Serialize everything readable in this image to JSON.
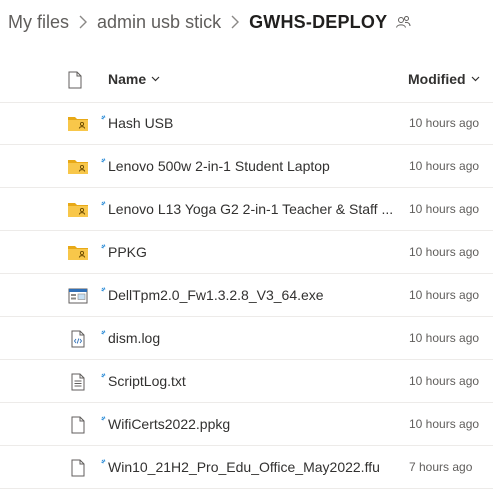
{
  "breadcrumb": {
    "items": [
      "My files",
      "admin usb stick"
    ],
    "current": "GWHS-DEPLOY"
  },
  "header": {
    "name_label": "Name",
    "modified_label": "Modified"
  },
  "files": [
    {
      "name": "Hash USB",
      "modified": "10 hours ago",
      "icon": "shared-folder-icon"
    },
    {
      "name": "Lenovo 500w 2-in-1 Student Laptop",
      "modified": "10 hours ago",
      "icon": "shared-folder-icon"
    },
    {
      "name": "Lenovo L13 Yoga G2 2-in-1 Teacher & Staff ...",
      "modified": "10 hours ago",
      "icon": "shared-folder-icon"
    },
    {
      "name": "PPKG",
      "modified": "10 hours ago",
      "icon": "shared-folder-icon"
    },
    {
      "name": "DellTpm2.0_Fw1.3.2.8_V3_64.exe",
      "modified": "10 hours ago",
      "icon": "exe-file-icon"
    },
    {
      "name": "dism.log",
      "modified": "10 hours ago",
      "icon": "code-file-icon"
    },
    {
      "name": "ScriptLog.txt",
      "modified": "10 hours ago",
      "icon": "text-file-icon"
    },
    {
      "name": "WifiCerts2022.ppkg",
      "modified": "10 hours ago",
      "icon": "generic-file-icon"
    },
    {
      "name": "Win10_21H2_Pro_Edu_Office_May2022.ffu",
      "modified": "7 hours ago",
      "icon": "generic-file-icon"
    }
  ],
  "colors": {
    "folder": "#f8c74a",
    "folder_back": "#e8a917",
    "new_marker": "#2f8ed8",
    "exe_accent": "#2f6fb7"
  }
}
